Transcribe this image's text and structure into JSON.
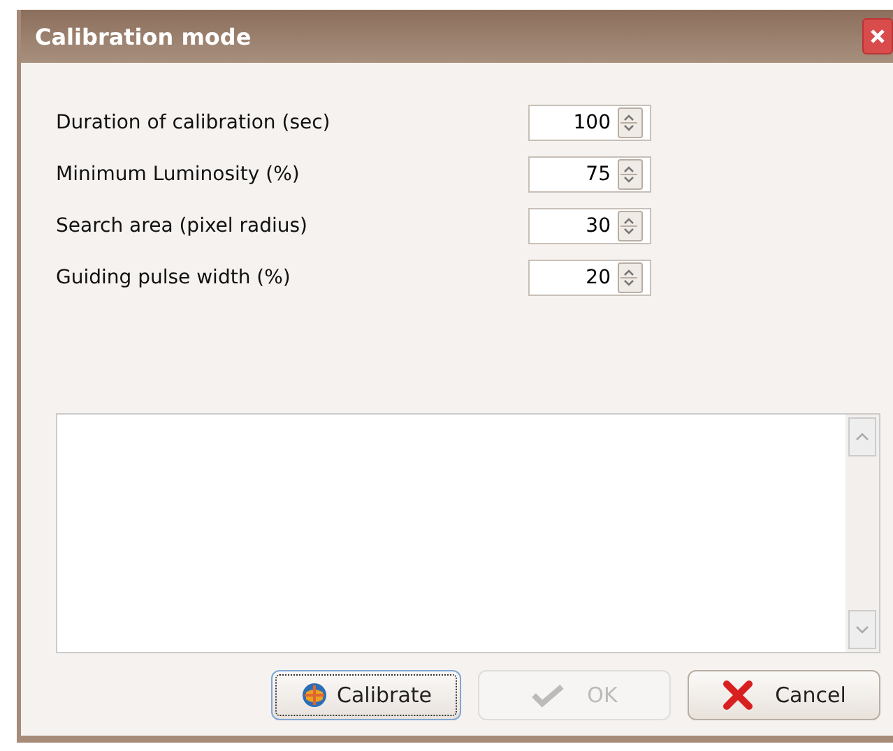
{
  "window": {
    "title": "Calibration mode"
  },
  "fields": [
    {
      "label": "Duration of calibration (sec)",
      "value": "100"
    },
    {
      "label": "Minimum Luminosity (%)",
      "value": "75"
    },
    {
      "label": "Search area (pixel radius)",
      "value": "30"
    },
    {
      "label": "Guiding pulse width (%)",
      "value": "20"
    }
  ],
  "buttons": [
    {
      "kind": "calibrate",
      "label": "Calibrate",
      "disabled": false,
      "focused": true
    },
    {
      "kind": "ok",
      "label": "OK",
      "disabled": true,
      "focused": false
    },
    {
      "kind": "cancel",
      "label": "Cancel",
      "disabled": false,
      "focused": false
    }
  ]
}
